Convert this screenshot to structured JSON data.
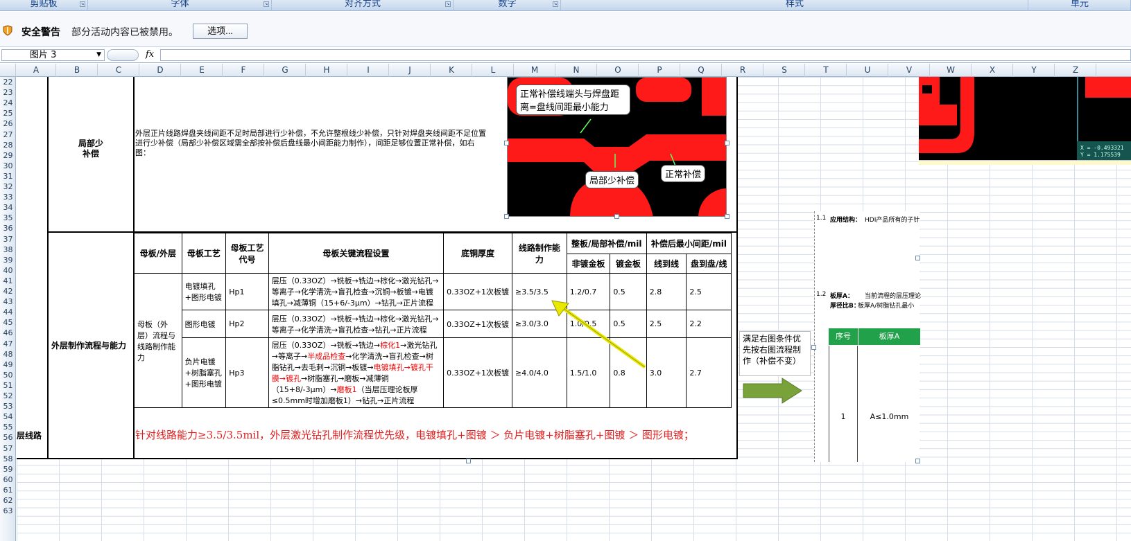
{
  "ribbon": {
    "groups": [
      "剪贴板",
      "字体",
      "对齐方式",
      "数字",
      "样式",
      "单元"
    ]
  },
  "security": {
    "title": "安全警告",
    "message": "部分活动内容已被禁用。",
    "options_button": "选项..."
  },
  "formula_bar": {
    "name_box": "图片 3",
    "fx": "fx"
  },
  "columns": [
    "A",
    "B",
    "C",
    "D",
    "E",
    "F",
    "G",
    "H",
    "I",
    "J",
    "K",
    "L",
    "M",
    "N",
    "O",
    "P",
    "Q",
    "R",
    "S",
    "T",
    "U",
    "V",
    "W",
    "X",
    "Y",
    "Z"
  ],
  "rows": [
    "22",
    "23",
    "24",
    "25",
    "26",
    "27",
    "28",
    "29",
    "30",
    "31",
    "32",
    "33",
    "34",
    "35",
    "36",
    "37",
    "38",
    "39",
    "40",
    "41",
    "42",
    "43",
    "44",
    "45",
    "46",
    "47",
    "48",
    "49",
    "50",
    "51",
    "52",
    "53",
    "54",
    "55",
    "56",
    "57",
    "58",
    "59",
    "60",
    "61",
    "62",
    "63"
  ],
  "sheet": {
    "col_a_label": "层线路",
    "section1": {
      "label_line1": "局部少",
      "label_line2": "补偿",
      "description": "外层正片线路焊盘夹线间距不足时局部进行少补偿，不允许整根线少补偿，只针对焊盘夹线间距不足位置进行少补偿（局部少补偿区域需全部按补偿后盘线最小间距能力制作），间距足够位置正常补偿，如右图：",
      "callout_top": "正常补偿线端头与焊盘距离=盘线间距最小能力",
      "callout_partial": "局部少补偿",
      "callout_normal": "正常补偿"
    },
    "section2": {
      "label": "外层制作流程与能力",
      "headers": {
        "mother_outer": "母板/外层",
        "process": "母板工艺",
        "code": "母板工艺代号",
        "flow": "母板关键流程设置",
        "copper": "底铜厚度",
        "line_cap": "线路制作能力",
        "comp_group": "整板/局部补偿/mil",
        "spacing_group": "补偿后最小间距/mil",
        "non_gold": "非镀金板",
        "gold": "镀金板",
        "line_line": "线到线",
        "pad_pad": "盘到盘/线"
      },
      "merged_cell": "母板（外层）流程与线路制作能力",
      "rows": [
        {
          "process": "电镀填孔+图形电镀",
          "code": "Hp1",
          "flow": "层压（0.33OZ）→铣板→铣边→棕化→激光钻孔→等离子→化学清洗→盲孔检查→沉铜→板镀→电镀填孔→减薄铜（15+6/-3μm）→钻孔→正片流程",
          "copper": "0.33OZ+1次板镀",
          "cap": "≥3.5/3.5",
          "non_gold": "1.2/0.7",
          "gold": "0.5",
          "ll": "2.8",
          "pp": "2.5"
        },
        {
          "process": "图形电镀",
          "code": "Hp2",
          "flow": "层压（0.33OZ）→铣板→铣边→棕化→激光钻孔→等离子→化学清洗→盲孔检查→钻孔→正片流程",
          "copper": "0.33OZ+1次板镀",
          "cap": "≥3.0/3.0",
          "non_gold": "1.0/0.5",
          "gold": "0.5",
          "ll": "2.5",
          "pp": "2.2"
        },
        {
          "process": "负片电镀+树脂塞孔+图形电镀",
          "code": "Hp3",
          "copper": "0.33OZ+1次板镀",
          "cap": "≥4.0/4.0",
          "non_gold": "1.5/1.0",
          "gold": "0.8",
          "ll": "3.0",
          "pp": "2.7"
        }
      ],
      "row3_flow_parts": {
        "a": "层压（0.33OZ）→铣板→铣边→",
        "b": "棕化1",
        "c": "→激光钻孔→等离子→",
        "d": "半成品检查",
        "e": "→化学清洗→盲孔检查→树脂钻孔→去毛刺→沉铜→板镀→",
        "f": "电镀填孔→镀孔干膜→镀孔",
        "g": "→树脂塞孔→磨板→减薄铜（15+8/-3μm）→",
        "h": "磨板1",
        "i": "（当层压理论板厚≤0.5mm时增加磨板1）→钻孔→正片流程"
      },
      "note": "针对线路能力≥3.5/3.5mil，外层激光钻孔制作流程优先级，电镀填孔+图镀 ＞ 负片电镀+树脂塞孔+图镀 ＞ 图形电镀；"
    },
    "side_box": "满足右图条件优先按右图流程制作（补偿不变）",
    "right_panel": {
      "line1_num": "1.1",
      "line1_label": "应用结构：",
      "line1_text": "HDI产品所有的子针",
      "line2_num": "1.2",
      "line2_label": "板厚A：",
      "line2_text": "当前流程的层压理论",
      "line3_label": "厚径比B：",
      "line3_text": "板厚A/树脂钻孔最小",
      "th_seq": "序号",
      "th_thick": "板厚A",
      "td_seq": "1",
      "td_thick": "A≤1.0mm"
    },
    "pcb2_readout": {
      "x": "X = -0.493321",
      "y": "Y = 1.175539"
    }
  },
  "colors": {
    "pcb_red": "#ff1a1a",
    "header_green": "#21a24a",
    "note_red": "#e32020"
  }
}
